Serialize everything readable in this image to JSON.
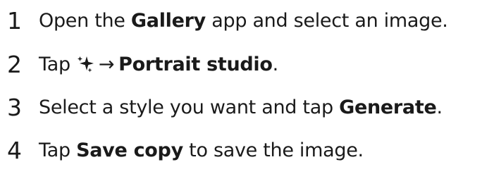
{
  "steps": [
    {
      "number": "1",
      "before": "Open the",
      "bold": "Gallery",
      "after": "app and select an image."
    },
    {
      "number": "2",
      "before": "Tap",
      "icon": "sparkle-icon",
      "arrow": "→",
      "bold": "Portrait studio",
      "after": "."
    },
    {
      "number": "3",
      "before": "Select a style you want and tap",
      "bold": "Generate",
      "after": "."
    },
    {
      "number": "4",
      "before": "Tap",
      "bold": "Save copy",
      "after": "to save the image."
    }
  ]
}
